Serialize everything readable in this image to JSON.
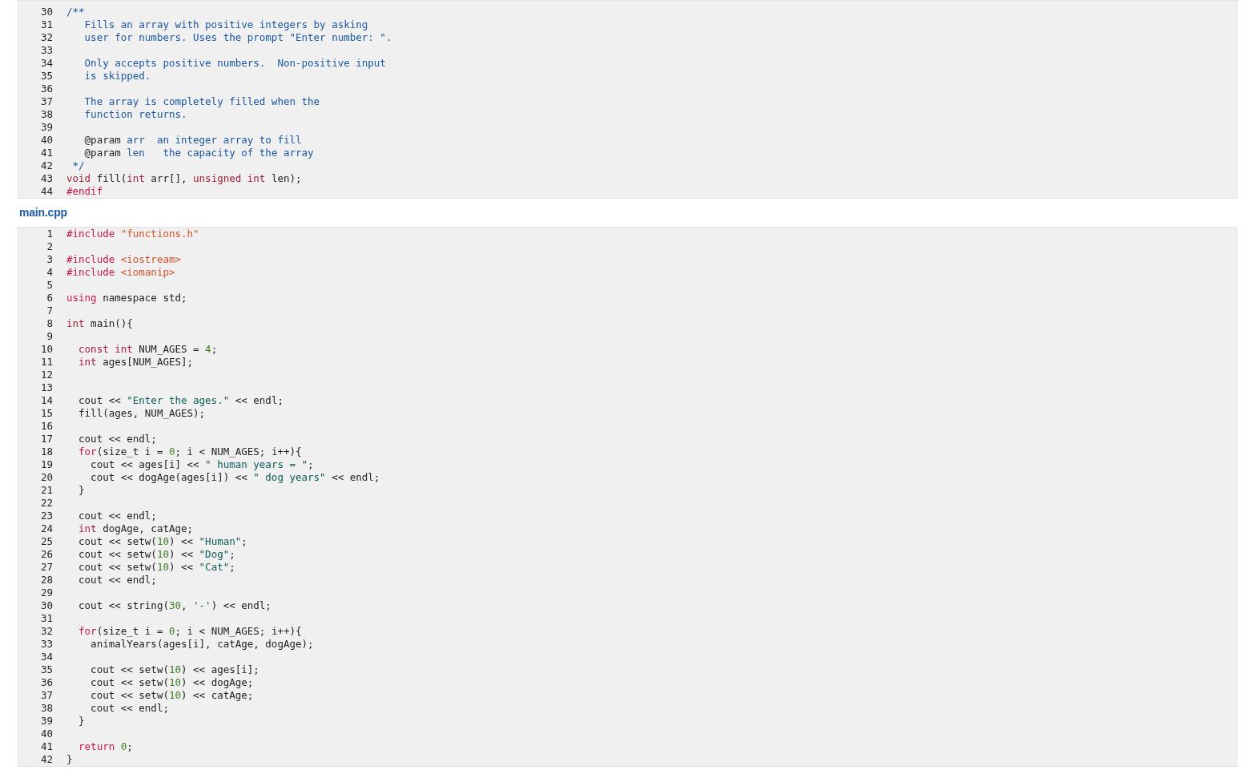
{
  "files": [
    {
      "lines": [
        {
          "n": "30",
          "tokens": [
            {
              "kind": "comment",
              "text": "/**"
            }
          ]
        },
        {
          "n": "31",
          "tokens": [
            {
              "kind": "comment",
              "text": "   Fills an array with positive integers by asking"
            }
          ]
        },
        {
          "n": "32",
          "tokens": [
            {
              "kind": "comment",
              "text": "   user for numbers. Uses the prompt \"Enter number: \"."
            }
          ]
        },
        {
          "n": "33"
        },
        {
          "n": "34",
          "tokens": [
            {
              "kind": "comment",
              "text": "   Only accepts positive numbers.  Non-positive input"
            }
          ]
        },
        {
          "n": "35",
          "tokens": [
            {
              "kind": "comment",
              "text": "   is skipped."
            }
          ]
        },
        {
          "n": "36"
        },
        {
          "n": "37",
          "tokens": [
            {
              "kind": "comment",
              "text": "   The array is completely filled when the"
            }
          ]
        },
        {
          "n": "38",
          "tokens": [
            {
              "kind": "comment",
              "text": "   function returns."
            }
          ]
        },
        {
          "n": "39"
        },
        {
          "n": "40",
          "tokens": [
            {
              "kind": "tag",
              "text": "   @param"
            },
            {
              "kind": "comment",
              "text": " arr  an integer array to fill"
            }
          ]
        },
        {
          "n": "41",
          "tokens": [
            {
              "kind": "tag",
              "text": "   @param"
            },
            {
              "kind": "comment",
              "text": " len   the capacity of the array"
            }
          ]
        },
        {
          "n": "42",
          "tokens": [
            {
              "kind": "comment",
              "text": " */"
            }
          ]
        },
        {
          "n": "43",
          "tokens": [
            {
              "kind": "type",
              "text": "void"
            },
            {
              "kind": "plain",
              "text": " fill("
            },
            {
              "kind": "type",
              "text": "int"
            },
            {
              "kind": "plain",
              "text": " arr[], "
            },
            {
              "kind": "type",
              "text": "unsigned int"
            },
            {
              "kind": "plain",
              "text": " len);"
            }
          ]
        },
        {
          "n": "44",
          "tokens": [
            {
              "kind": "preprocessor",
              "text": "#endif"
            }
          ]
        }
      ]
    },
    {
      "title": "main.cpp",
      "lines": [
        {
          "n": "1",
          "tokens": [
            {
              "kind": "preprocessor",
              "text": "#include"
            },
            {
              "kind": "header",
              "text": " \"functions.h\""
            }
          ]
        },
        {
          "n": "2"
        },
        {
          "n": "3",
          "tokens": [
            {
              "kind": "preprocessor",
              "text": "#include"
            },
            {
              "kind": "header",
              "text": " <iostream>"
            }
          ]
        },
        {
          "n": "4",
          "tokens": [
            {
              "kind": "preprocessor",
              "text": "#include"
            },
            {
              "kind": "header",
              "text": " <iomanip>"
            }
          ]
        },
        {
          "n": "5"
        },
        {
          "n": "6",
          "tokens": [
            {
              "kind": "keyword",
              "text": "using"
            },
            {
              "kind": "plain",
              "text": " namespace std;"
            }
          ]
        },
        {
          "n": "7"
        },
        {
          "n": "8",
          "tokens": [
            {
              "kind": "type",
              "text": "int"
            },
            {
              "kind": "plain",
              "text": " main(){"
            }
          ]
        },
        {
          "n": "9"
        },
        {
          "n": "10",
          "tokens": [
            {
              "kind": "type",
              "text": "  const int"
            },
            {
              "kind": "plain",
              "text": " NUM_AGES = "
            },
            {
              "kind": "number",
              "text": "4"
            },
            {
              "kind": "plain",
              "text": ";"
            }
          ]
        },
        {
          "n": "11",
          "tokens": [
            {
              "kind": "type",
              "text": "  int"
            },
            {
              "kind": "plain",
              "text": " ages[NUM_AGES];"
            }
          ]
        },
        {
          "n": "12"
        },
        {
          "n": "13"
        },
        {
          "n": "14",
          "tokens": [
            {
              "kind": "plain",
              "text": "  cout << "
            },
            {
              "kind": "string",
              "text": "\"Enter the ages.\""
            },
            {
              "kind": "plain",
              "text": " << endl;"
            }
          ]
        },
        {
          "n": "15",
          "tokens": [
            {
              "kind": "plain",
              "text": "  fill(ages, NUM_AGES);"
            }
          ]
        },
        {
          "n": "16"
        },
        {
          "n": "17",
          "tokens": [
            {
              "kind": "plain",
              "text": "  cout << endl;"
            }
          ]
        },
        {
          "n": "18",
          "tokens": [
            {
              "kind": "keyword",
              "text": "  for"
            },
            {
              "kind": "plain",
              "text": "(size_t i = "
            },
            {
              "kind": "number",
              "text": "0"
            },
            {
              "kind": "plain",
              "text": "; i < NUM_AGES; i++){"
            }
          ]
        },
        {
          "n": "19",
          "tokens": [
            {
              "kind": "plain",
              "text": "    cout << ages[i] << "
            },
            {
              "kind": "string",
              "text": "\" human years = \""
            },
            {
              "kind": "plain",
              "text": ";"
            }
          ]
        },
        {
          "n": "20",
          "tokens": [
            {
              "kind": "plain",
              "text": "    cout << dogAge(ages[i]) << "
            },
            {
              "kind": "string",
              "text": "\" dog years\""
            },
            {
              "kind": "plain",
              "text": " << endl;"
            }
          ]
        },
        {
          "n": "21",
          "tokens": [
            {
              "kind": "plain",
              "text": "  }"
            }
          ]
        },
        {
          "n": "22"
        },
        {
          "n": "23",
          "tokens": [
            {
              "kind": "plain",
              "text": "  cout << endl;"
            }
          ]
        },
        {
          "n": "24",
          "tokens": [
            {
              "kind": "type",
              "text": "  int"
            },
            {
              "kind": "plain",
              "text": " dogAge, catAge;"
            }
          ]
        },
        {
          "n": "25",
          "tokens": [
            {
              "kind": "plain",
              "text": "  cout << setw("
            },
            {
              "kind": "number",
              "text": "10"
            },
            {
              "kind": "plain",
              "text": ") << "
            },
            {
              "kind": "string",
              "text": "\"Human\""
            },
            {
              "kind": "plain",
              "text": ";"
            }
          ]
        },
        {
          "n": "26",
          "tokens": [
            {
              "kind": "plain",
              "text": "  cout << setw("
            },
            {
              "kind": "number",
              "text": "10"
            },
            {
              "kind": "plain",
              "text": ") << "
            },
            {
              "kind": "string",
              "text": "\"Dog\""
            },
            {
              "kind": "plain",
              "text": ";"
            }
          ]
        },
        {
          "n": "27",
          "tokens": [
            {
              "kind": "plain",
              "text": "  cout << setw("
            },
            {
              "kind": "number",
              "text": "10"
            },
            {
              "kind": "plain",
              "text": ") << "
            },
            {
              "kind": "string",
              "text": "\"Cat\""
            },
            {
              "kind": "plain",
              "text": ";"
            }
          ]
        },
        {
          "n": "28",
          "tokens": [
            {
              "kind": "plain",
              "text": "  cout << endl;"
            }
          ]
        },
        {
          "n": "29"
        },
        {
          "n": "30",
          "tokens": [
            {
              "kind": "plain",
              "text": "  cout << string("
            },
            {
              "kind": "number",
              "text": "30"
            },
            {
              "kind": "plain",
              "text": ", "
            },
            {
              "kind": "string",
              "text": "'-'"
            },
            {
              "kind": "plain",
              "text": ") << endl;"
            }
          ]
        },
        {
          "n": "31"
        },
        {
          "n": "32",
          "tokens": [
            {
              "kind": "keyword",
              "text": "  for"
            },
            {
              "kind": "plain",
              "text": "(size_t i = "
            },
            {
              "kind": "number",
              "text": "0"
            },
            {
              "kind": "plain",
              "text": "; i < NUM_AGES; i++){"
            }
          ]
        },
        {
          "n": "33",
          "tokens": [
            {
              "kind": "plain",
              "text": "    animalYears(ages[i], catAge, dogAge);"
            }
          ]
        },
        {
          "n": "34"
        },
        {
          "n": "35",
          "tokens": [
            {
              "kind": "plain",
              "text": "    cout << setw("
            },
            {
              "kind": "number",
              "text": "10"
            },
            {
              "kind": "plain",
              "text": ") << ages[i];"
            }
          ]
        },
        {
          "n": "36",
          "tokens": [
            {
              "kind": "plain",
              "text": "    cout << setw("
            },
            {
              "kind": "number",
              "text": "10"
            },
            {
              "kind": "plain",
              "text": ") << dogAge;"
            }
          ]
        },
        {
          "n": "37",
          "tokens": [
            {
              "kind": "plain",
              "text": "    cout << setw("
            },
            {
              "kind": "number",
              "text": "10"
            },
            {
              "kind": "plain",
              "text": ") << catAge;"
            }
          ]
        },
        {
          "n": "38",
          "tokens": [
            {
              "kind": "plain",
              "text": "    cout << endl;"
            }
          ]
        },
        {
          "n": "39",
          "tokens": [
            {
              "kind": "plain",
              "text": "  }"
            }
          ]
        },
        {
          "n": "40"
        },
        {
          "n": "41",
          "tokens": [
            {
              "kind": "keyword",
              "text": "  return"
            },
            {
              "kind": "number",
              "text": " 0"
            },
            {
              "kind": "plain",
              "text": ";"
            }
          ]
        },
        {
          "n": "42",
          "tokens": [
            {
              "kind": "plain",
              "text": "}"
            }
          ]
        }
      ]
    }
  ]
}
